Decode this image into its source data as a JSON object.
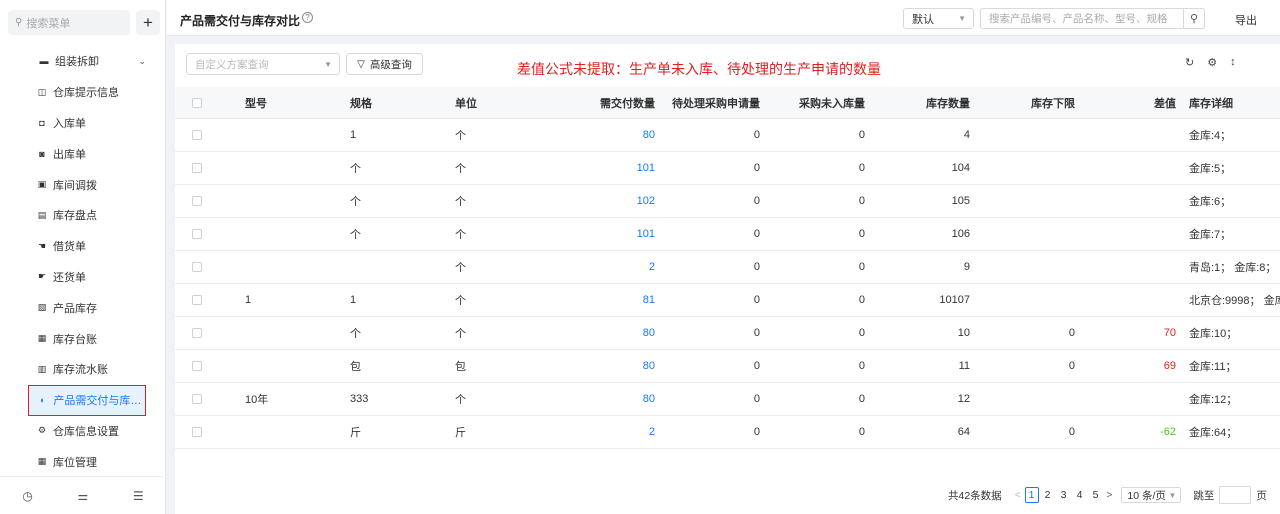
{
  "sidebar": {
    "search_placeholder": "搜索菜单",
    "add_label": "+",
    "items": [
      {
        "label": "组装拆卸",
        "icon": "folder-icon",
        "glyph": "▬",
        "group": true
      },
      {
        "label": "仓库提示信息",
        "icon": "info-card-icon",
        "glyph": "◫"
      },
      {
        "label": "入库单",
        "icon": "inbound-icon",
        "glyph": "◘"
      },
      {
        "label": "出库单",
        "icon": "outbound-icon",
        "glyph": "◙"
      },
      {
        "label": "库间调拨",
        "icon": "transfer-icon",
        "glyph": "▣"
      },
      {
        "label": "库存盘点",
        "icon": "inventory-check-icon",
        "glyph": "▤"
      },
      {
        "label": "借货单",
        "icon": "borrow-icon",
        "glyph": "☚"
      },
      {
        "label": "还货单",
        "icon": "return-icon",
        "glyph": "☛"
      },
      {
        "label": "产品库存",
        "icon": "product-stock-icon",
        "glyph": "▧"
      },
      {
        "label": "库存台账",
        "icon": "ledger-icon",
        "glyph": "▦"
      },
      {
        "label": "库存流水账",
        "icon": "flow-ledger-icon",
        "glyph": "▥"
      },
      {
        "label": "产品需交付与库存...",
        "icon": "pie-chart-icon",
        "glyph": "◐",
        "active": true
      },
      {
        "label": "仓库信息设置",
        "icon": "gear-icon",
        "glyph": "⚙"
      },
      {
        "label": "库位管理",
        "icon": "grid-icon",
        "glyph": "▦"
      }
    ],
    "footer_icons": [
      {
        "icon": "history-icon",
        "glyph": "◷"
      },
      {
        "icon": "sliders-icon",
        "glyph": "⚌"
      },
      {
        "icon": "collapse-menu-icon",
        "glyph": "☰"
      }
    ]
  },
  "header": {
    "title": "产品需交付与库存对比",
    "help_glyph": "?",
    "sort_select": "默认",
    "search_placeholder": "搜索产品编号、产品名称、型号、规格",
    "export_label": "导出"
  },
  "toolbar": {
    "scheme_placeholder": "自定义方案查询",
    "advanced_label": "高级查询",
    "annotation": "差值公式未提取：生产单未入库、待处理的生产申请的数量"
  },
  "table": {
    "columns": [
      "型号",
      "规格",
      "单位",
      "需交付数量",
      "待处理采购申请量",
      "采购未入库量",
      "库存数量",
      "库存下限",
      "差值",
      "库存详细"
    ],
    "rows": [
      {
        "model": "",
        "spec": "1",
        "unit": "个",
        "demand": "80",
        "pending": "0",
        "purchase": "0",
        "stock": "4",
        "lower": "",
        "diff": "",
        "diff_type": "",
        "detail": "金库:4；"
      },
      {
        "model": "",
        "spec": "个",
        "unit": "个",
        "demand": "101",
        "pending": "0",
        "purchase": "0",
        "stock": "104",
        "lower": "",
        "diff": "",
        "diff_type": "",
        "detail": "金库:5；"
      },
      {
        "model": "",
        "spec": "个",
        "unit": "个",
        "demand": "102",
        "pending": "0",
        "purchase": "0",
        "stock": "105",
        "lower": "",
        "diff": "",
        "diff_type": "",
        "detail": "金库:6；"
      },
      {
        "model": "",
        "spec": "个",
        "unit": "个",
        "demand": "101",
        "pending": "0",
        "purchase": "0",
        "stock": "106",
        "lower": "",
        "diff": "",
        "diff_type": "",
        "detail": "金库:7；"
      },
      {
        "model": "",
        "spec": "",
        "unit": "个",
        "demand": "2",
        "pending": "0",
        "purchase": "0",
        "stock": "9",
        "lower": "",
        "diff": "",
        "diff_type": "",
        "detail": "青岛:1；  金库:8；"
      },
      {
        "model": "1",
        "spec": "1",
        "unit": "个",
        "demand": "81",
        "pending": "0",
        "purchase": "0",
        "stock": "10107",
        "lower": "",
        "diff": "",
        "diff_type": "",
        "detail": "北京仓:9998；  金库"
      },
      {
        "model": "",
        "spec": "个",
        "unit": "个",
        "demand": "80",
        "pending": "0",
        "purchase": "0",
        "stock": "10",
        "lower": "0",
        "diff": "70",
        "diff_type": "pos",
        "detail": "金库:10；"
      },
      {
        "model": "",
        "spec": "包",
        "unit": "包",
        "demand": "80",
        "pending": "0",
        "purchase": "0",
        "stock": "11",
        "lower": "0",
        "diff": "69",
        "diff_type": "pos",
        "detail": "金库:11；"
      },
      {
        "model": "10年",
        "spec": "333",
        "unit": "个",
        "demand": "80",
        "pending": "0",
        "purchase": "0",
        "stock": "12",
        "lower": "",
        "diff": "",
        "diff_type": "",
        "detail": "金库:12；"
      },
      {
        "model": "",
        "spec": "斤",
        "unit": "斤",
        "demand": "2",
        "pending": "0",
        "purchase": "0",
        "stock": "64",
        "lower": "0",
        "diff": "-62",
        "diff_type": "neg",
        "detail": "金库:64；"
      }
    ]
  },
  "pagination": {
    "total": "共42条数据",
    "pages": [
      "1",
      "2",
      "3",
      "4",
      "5"
    ],
    "current": "1",
    "page_size": "10 条/页",
    "goto_label": "跳至",
    "page_suffix": "页"
  }
}
